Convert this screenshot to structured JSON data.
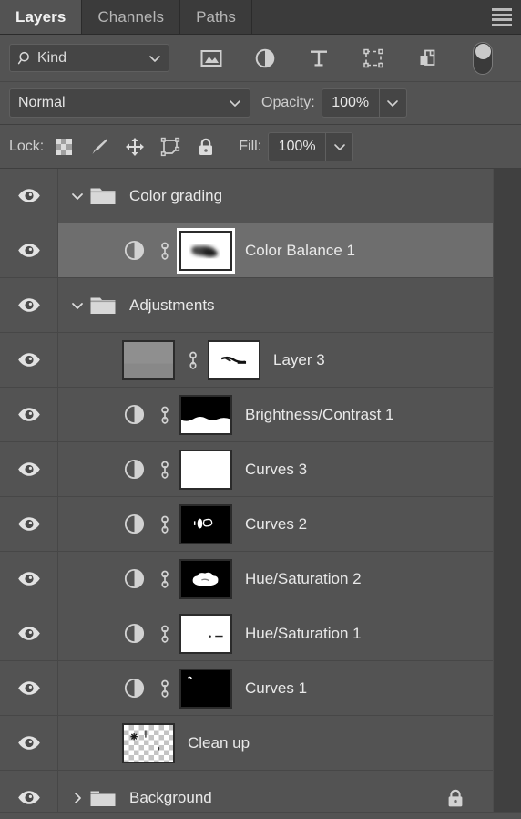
{
  "panel": {
    "tabs": [
      {
        "label": "Layers",
        "active": true
      },
      {
        "label": "Channels",
        "active": false
      },
      {
        "label": "Paths",
        "active": false
      }
    ],
    "menu_icon": "hamburger-menu-icon"
  },
  "filter": {
    "search_icon": "magnifier-icon",
    "kind_label": "Kind",
    "chevron_icon": "chevron-down-icon",
    "icons": [
      {
        "name": "filter-pixel-layers-icon",
        "title": "Pixel layers"
      },
      {
        "name": "filter-adjustment-layers-icon",
        "title": "Adjustment layers"
      },
      {
        "name": "filter-type-layers-icon",
        "title": "Type layers"
      },
      {
        "name": "filter-shape-layers-icon",
        "title": "Shape layers"
      },
      {
        "name": "filter-smart-object-icon",
        "title": "Smart objects"
      }
    ],
    "toggle": {
      "name": "filter-enable-toggle",
      "state": "on"
    }
  },
  "blend": {
    "mode": "Normal",
    "mode_chevron": "chevron-down-icon",
    "opacity_label": "Opacity:",
    "opacity_value": "100%",
    "opacity_stepper": "chevron-down-icon"
  },
  "lock": {
    "label": "Lock:",
    "fill_label": "Fill:",
    "fill_value": "100%",
    "fill_stepper": "chevron-down-icon",
    "icons": [
      {
        "name": "lock-transparent-pixels-icon"
      },
      {
        "name": "lock-image-pixels-icon"
      },
      {
        "name": "lock-position-icon"
      },
      {
        "name": "lock-artboard-nesting-icon"
      },
      {
        "name": "lock-all-icon"
      }
    ]
  },
  "layers": [
    {
      "name": "Color grading",
      "type": "group",
      "expanded": true,
      "indent": 0,
      "visible": true,
      "selected": false,
      "locked": false
    },
    {
      "name": "Color Balance 1",
      "type": "adjustment",
      "indent": 1,
      "visible": true,
      "selected": true,
      "locked": false,
      "mask": "blurred-dark-blob-on-white",
      "linked": true
    },
    {
      "name": "Adjustments",
      "type": "group",
      "expanded": true,
      "indent": 0,
      "visible": true,
      "selected": false,
      "locked": false
    },
    {
      "name": "Layer 3",
      "type": "pixel",
      "indent": 1,
      "visible": true,
      "selected": false,
      "locked": false,
      "mask": "small-dark-strokes-on-white",
      "linked": true
    },
    {
      "name": "Brightness/Contrast 1",
      "type": "adjustment",
      "indent": 1,
      "visible": true,
      "selected": false,
      "locked": false,
      "mask": "black-top-white-bottom",
      "linked": true
    },
    {
      "name": "Curves 3",
      "type": "adjustment",
      "indent": 1,
      "visible": true,
      "selected": false,
      "locked": false,
      "mask": "all-white",
      "linked": true
    },
    {
      "name": "Curves 2",
      "type": "adjustment",
      "indent": 1,
      "visible": true,
      "selected": false,
      "locked": false,
      "mask": "black-with-small-white-marks",
      "linked": true
    },
    {
      "name": "Hue/Saturation 2",
      "type": "adjustment",
      "indent": 1,
      "visible": true,
      "selected": false,
      "locked": false,
      "mask": "black-with-white-cloud-blob",
      "linked": true
    },
    {
      "name": "Hue/Saturation 1",
      "type": "adjustment",
      "indent": 1,
      "visible": true,
      "selected": false,
      "locked": false,
      "mask": "white-with-small-dark-marks",
      "linked": true
    },
    {
      "name": "Curves 1",
      "type": "adjustment",
      "indent": 1,
      "visible": true,
      "selected": false,
      "locked": false,
      "mask": "black-with-tiny-white-mark",
      "linked": true
    },
    {
      "name": "Clean up",
      "type": "pixel",
      "indent": 1,
      "visible": true,
      "selected": false,
      "locked": false,
      "thumbnail": "transparent-checkerboard-with-marks",
      "linked": false
    },
    {
      "name": "Background",
      "type": "group",
      "expanded": false,
      "indent": 0,
      "visible": true,
      "selected": false,
      "locked": true
    }
  ],
  "colors": {
    "panel_bg": "#535353",
    "row_bg": "#535353",
    "row_selected_bg": "#6e6e6e",
    "tabbar_bg": "#3b3b3b",
    "divider": "#474747",
    "text": "#e9e9e9",
    "muted_text": "#b6b6b6",
    "field_bg": "#454545",
    "scroll_gutter": "#404040"
  }
}
